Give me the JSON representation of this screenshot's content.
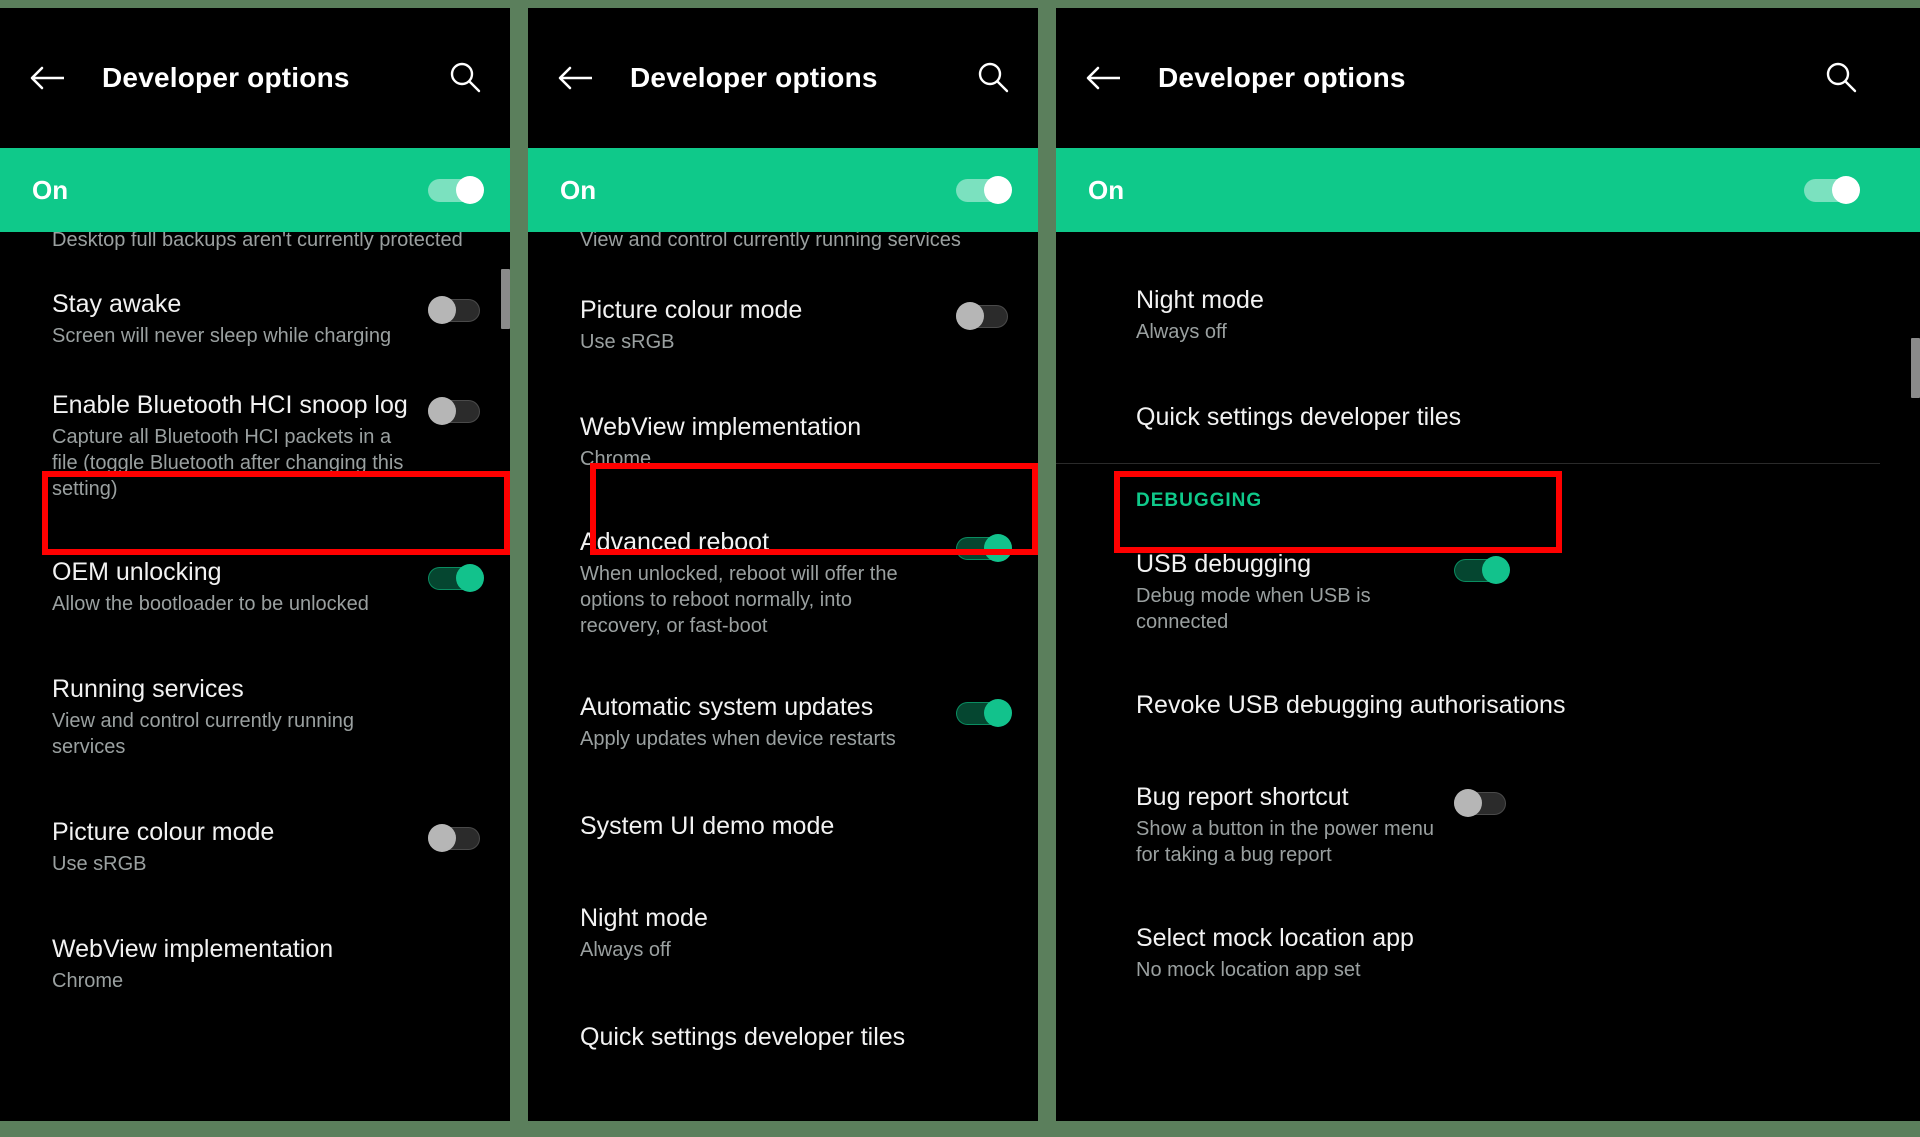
{
  "appbar": {
    "title": "Developer options",
    "back_icon": "arrow-left-icon",
    "search_icon": "search-icon"
  },
  "master": {
    "label": "On",
    "state": "on"
  },
  "colors": {
    "accent_green": "#0fc98a",
    "highlight_red": "#ff0000",
    "background": "#000000",
    "frame_green": "#5b7f5c",
    "subtitle_grey": "#9aa0a0"
  },
  "panels": [
    {
      "id": "panel-1",
      "orphan_line": "Desktop full backups aren't currently protected",
      "rows": [
        {
          "title": "Stay awake",
          "sub": "Screen will never sleep while charging",
          "control": "switch",
          "state": "off",
          "highlighted": false
        },
        {
          "title": "Enable Bluetooth HCI snoop log",
          "sub": "Capture all Bluetooth HCI packets in a file (toggle Bluetooth after changing this setting)",
          "control": "switch",
          "state": "off",
          "highlighted": false
        },
        {
          "title": "OEM unlocking",
          "sub": "Allow the bootloader to be unlocked",
          "control": "switch",
          "state": "on",
          "highlighted": true
        },
        {
          "title": "Running services",
          "sub": "View and control currently running services",
          "control": "none",
          "state": "",
          "highlighted": false
        },
        {
          "title": "Picture colour mode",
          "sub": "Use sRGB",
          "control": "switch",
          "state": "off",
          "highlighted": false
        },
        {
          "title": "WebView implementation",
          "sub": "Chrome",
          "control": "none",
          "state": "",
          "highlighted": false
        }
      ]
    },
    {
      "id": "panel-2",
      "orphan_line": "View and control currently running services",
      "rows": [
        {
          "title": "Picture colour mode",
          "sub": "Use sRGB",
          "control": "switch",
          "state": "off",
          "highlighted": false
        },
        {
          "title": "WebView implementation",
          "sub": "Chrome",
          "control": "none",
          "state": "",
          "highlighted": false
        },
        {
          "title": "Advanced reboot",
          "sub": "When unlocked, reboot will offer the options to reboot normally, into recovery, or fast-boot",
          "control": "switch",
          "state": "on",
          "highlighted": true
        },
        {
          "title": "Automatic system updates",
          "sub": "Apply updates when device restarts",
          "control": "switch",
          "state": "on",
          "highlighted": false
        },
        {
          "title": "System UI demo mode",
          "sub": "",
          "control": "none",
          "state": "",
          "highlighted": false
        },
        {
          "title": "Night mode",
          "sub": "Always off",
          "control": "none",
          "state": "",
          "highlighted": false
        },
        {
          "title": "Quick settings developer tiles",
          "sub": "",
          "control": "none",
          "state": "",
          "highlighted": false
        }
      ]
    },
    {
      "id": "panel-3",
      "orphan_line": "",
      "section_label": "DEBUGGING",
      "rows": [
        {
          "title": "Night mode",
          "sub": "Always off",
          "control": "none",
          "state": "",
          "highlighted": false
        },
        {
          "title": "Quick settings developer tiles",
          "sub": "",
          "control": "none",
          "state": "",
          "highlighted": false
        },
        {
          "title": "USB debugging",
          "sub": "Debug mode when USB is connected",
          "control": "switch",
          "state": "on",
          "highlighted": true
        },
        {
          "title": "Revoke USB debugging authorisations",
          "sub": "",
          "control": "none",
          "state": "",
          "highlighted": false
        },
        {
          "title": "Bug report shortcut",
          "sub": "Show a button in the power menu for taking a bug report",
          "control": "switch",
          "state": "off",
          "highlighted": false
        },
        {
          "title": "Select mock location app",
          "sub": "No mock location app set",
          "control": "none",
          "state": "",
          "highlighted": false
        }
      ]
    }
  ]
}
